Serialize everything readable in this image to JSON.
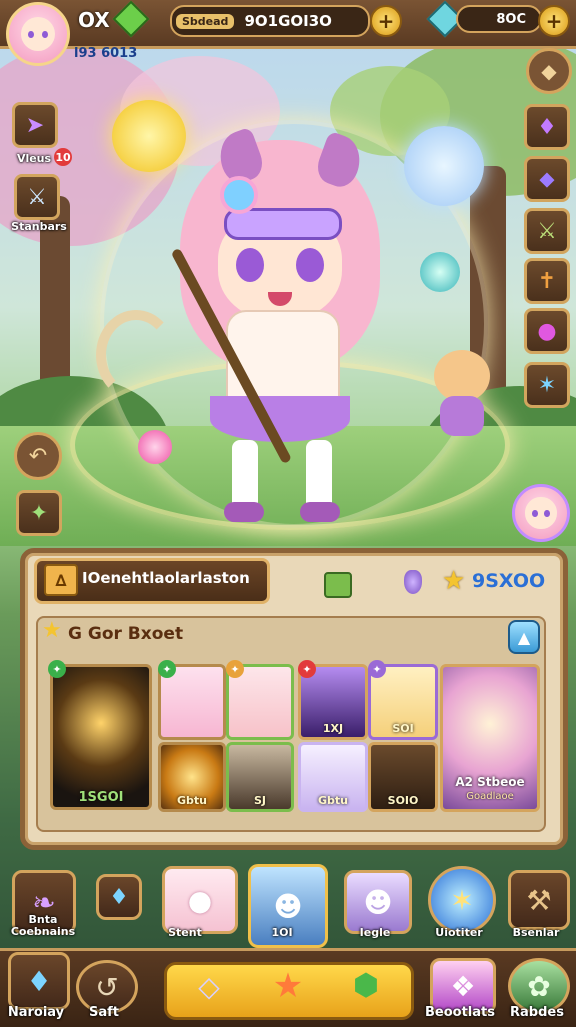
{
  "top": {
    "level_label": "OX",
    "player_id": "l93 6013",
    "pill1_label": "Sbdead",
    "pill1_value": "9O1GOI3O",
    "pill2_value": "8OC"
  },
  "left_menu": [
    {
      "label": "Vleus",
      "badge": "10",
      "icon": "arrows-icon"
    },
    {
      "label": "Stanbars",
      "icon": "sword-icon"
    }
  ],
  "right_menu": [
    {
      "icon": "gem-icon"
    },
    {
      "icon": "crystal-icon"
    },
    {
      "icon": "crossed-swords-icon"
    },
    {
      "icon": "dagger-icon"
    },
    {
      "icon": "orb-icon"
    },
    {
      "icon": "lightning-icon"
    }
  ],
  "character": {
    "name": "IOenehtlaolarlaston",
    "stars_value": "9SXOO"
  },
  "collection": {
    "title": "G Gor Bxoet",
    "featured": {
      "label": "1SGOI"
    },
    "portraits": [
      {
        "label": "",
        "color": "#f7b6d2"
      },
      {
        "label": "",
        "color": "#f7c2c9"
      },
      {
        "label": "1XJ",
        "color": "#8a5cc8"
      },
      {
        "label": "SOI",
        "color": "#f5d07a"
      }
    ],
    "row2": [
      {
        "label": "Gbtu"
      },
      {
        "label": "SJ"
      },
      {
        "label": "Gbtu"
      },
      {
        "label": "SOIO"
      }
    ],
    "spotlight": {
      "title": "A2 Stbeoe",
      "subtitle": "Goadlaoe"
    }
  },
  "bottom_shelf": [
    {
      "label": "Bnta Coebnains"
    },
    {
      "label": ""
    },
    {
      "label": "Stent"
    },
    {
      "label": "1OI"
    },
    {
      "label": "Iegle"
    },
    {
      "label": "Uiotiter"
    },
    {
      "label": "Bsenlar"
    }
  ],
  "bottom_bar": [
    {
      "label": "Naroiay"
    },
    {
      "label": "Saft"
    },
    {
      "label": "Beootlats"
    },
    {
      "label": "Rabdes"
    }
  ],
  "colors": {
    "frame": "#8b6238",
    "gold": "#e0b268",
    "panel": "#e9d8b8",
    "accent_blue": "#2a6fd6",
    "accent_pink": "#f39ac0"
  }
}
